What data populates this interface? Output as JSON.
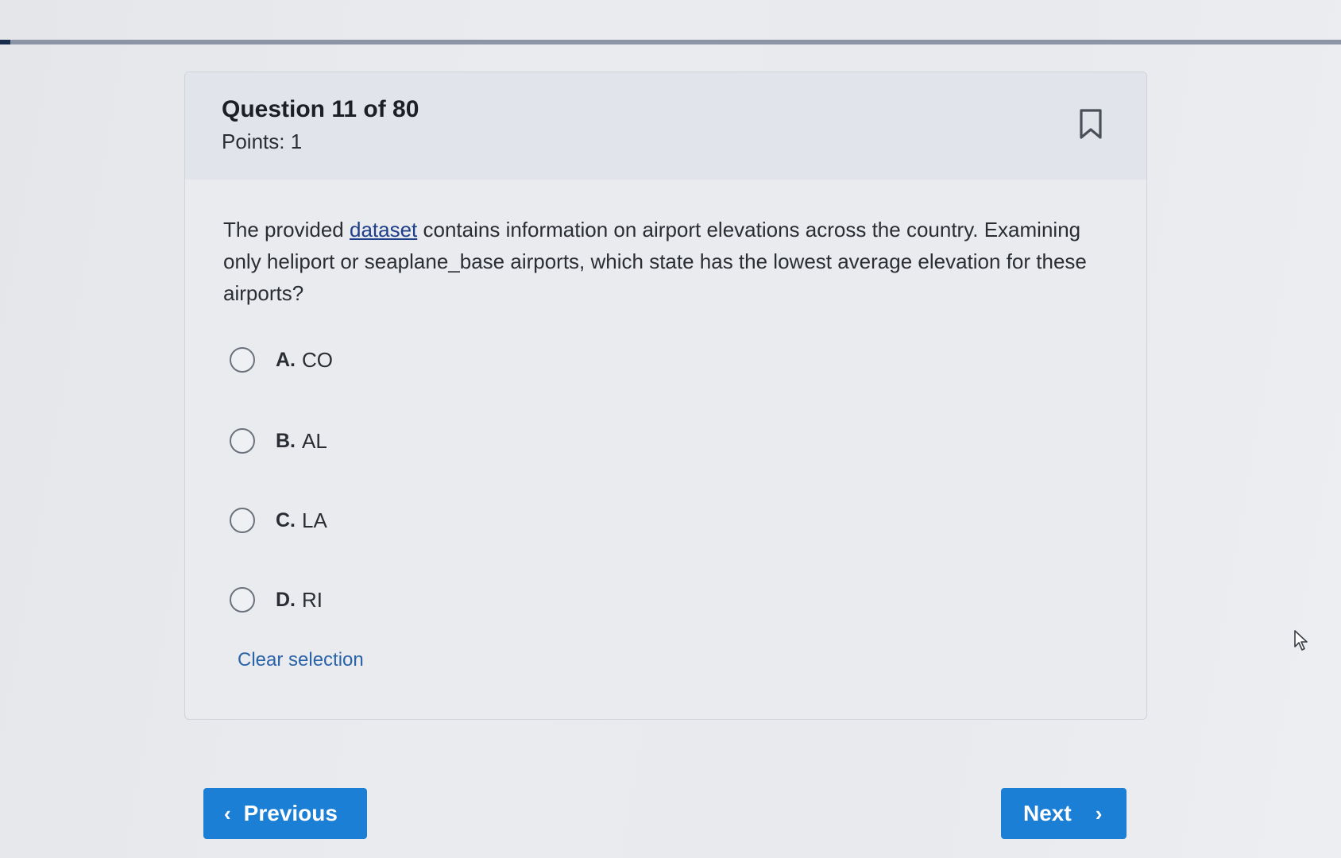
{
  "progress": {
    "current": 11,
    "total": 80,
    "fraction": 0.0075
  },
  "question": {
    "title": "Question 11 of 80",
    "points": "Points: 1",
    "text_before": "The provided ",
    "link_text": "dataset",
    "text_after": " contains information on airport elevations across the country. Examining only heliport or seaplane_base airports, which state has the lowest average elevation for these airports?"
  },
  "options": [
    {
      "letter": "A.",
      "text": "CO"
    },
    {
      "letter": "B.",
      "text": "AL"
    },
    {
      "letter": "C.",
      "text": "LA"
    },
    {
      "letter": "D.",
      "text": "RI"
    }
  ],
  "clear_selection": "Clear selection",
  "nav": {
    "previous": "Previous",
    "next": "Next"
  },
  "icons": {
    "bookmark": "bookmark-icon",
    "prev_chevron": "chevron-left-icon",
    "next_chevron": "chevron-right-icon",
    "cursor": "mouse-cursor-icon"
  },
  "colors": {
    "primary_button": "#1c7fd6",
    "link": "#1f3f8a",
    "clear_link": "#2a63a8",
    "progress_fill": "#1a2c4e"
  }
}
